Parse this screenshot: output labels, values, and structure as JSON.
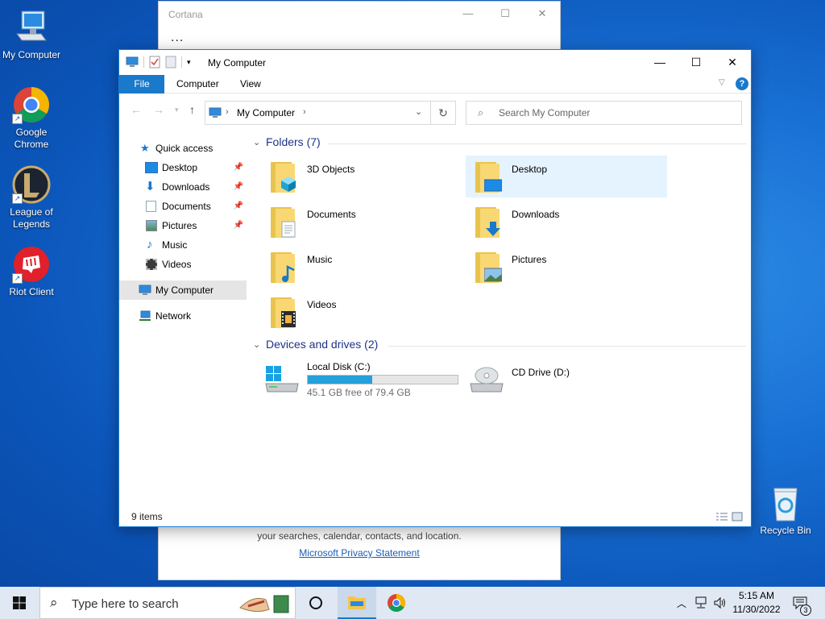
{
  "desktop": {
    "icons": [
      {
        "label": "My Computer"
      },
      {
        "label": "Google Chrome"
      },
      {
        "label": "League of Legends"
      },
      {
        "label": "Riot Client"
      },
      {
        "label": "Recycle Bin"
      }
    ],
    "shortcut_glyph": "↗"
  },
  "cortana": {
    "title": "Cortana",
    "dots": "...",
    "footer_text": "your searches, calendar, contacts, and location.",
    "privacy_link": "Microsoft Privacy Statement"
  },
  "explorer": {
    "title": "My Computer",
    "tabs": {
      "file": "File",
      "computer": "Computer",
      "view": "View"
    },
    "address": {
      "crumb": "My Computer"
    },
    "search_placeholder": "Search My Computer",
    "nav": {
      "quick_access": "Quick access",
      "items": [
        {
          "label": "Desktop",
          "pinned": true
        },
        {
          "label": "Downloads",
          "pinned": true
        },
        {
          "label": "Documents",
          "pinned": true
        },
        {
          "label": "Pictures",
          "pinned": true
        },
        {
          "label": "Music",
          "pinned": false
        },
        {
          "label": "Videos",
          "pinned": false
        }
      ],
      "my_computer": "My Computer",
      "network": "Network"
    },
    "groups": {
      "folders_header": "Folders (7)",
      "drives_header": "Devices and drives (2)"
    },
    "folders": [
      {
        "name": "3D Objects"
      },
      {
        "name": "Desktop"
      },
      {
        "name": "Documents"
      },
      {
        "name": "Downloads"
      },
      {
        "name": "Music"
      },
      {
        "name": "Pictures"
      },
      {
        "name": "Videos"
      }
    ],
    "drives": [
      {
        "name": "Local Disk (C:)",
        "free_text": "45.1 GB free of 79.4 GB",
        "used_fraction": 0.432
      },
      {
        "name": "CD Drive (D:)"
      }
    ],
    "status": {
      "item_count": "9 items"
    }
  },
  "taskbar": {
    "search_placeholder": "Type here to search",
    "clock_time": "5:15 AM",
    "clock_date": "11/30/2022",
    "notification_count": "3"
  },
  "colors": {
    "accent": "#1979ca",
    "selection": "#e5f3ff",
    "drive_bar": "#26a0da",
    "header_text": "#1e3287"
  }
}
